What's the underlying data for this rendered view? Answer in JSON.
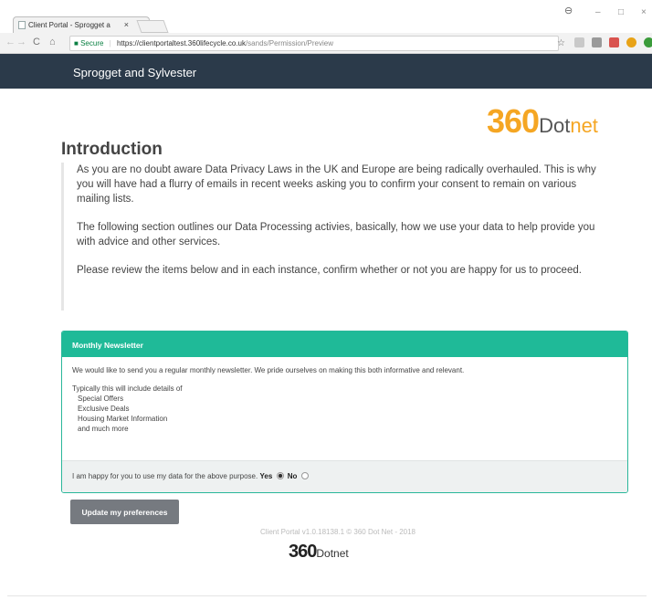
{
  "browser": {
    "tab_title": "Client Portal - Sprogget a",
    "tab_close": "×",
    "url_secure_label": "Secure",
    "url_host": "https://clientportaltest.360lifecycle.co.uk",
    "url_path": "/sands/Permission/Preview",
    "minimize": "–",
    "maximize": "□",
    "close": "×",
    "profile": "⊖"
  },
  "header": {
    "company_name": "Sprogget and Sylvester"
  },
  "logo": {
    "number": "360",
    "word_dot": "Dot",
    "word_net": "net"
  },
  "intro": {
    "title": "Introduction",
    "paragraphs": [
      "As you are no doubt aware Data Privacy Laws in the UK and Europe are being radically overhauled.  This is why you will have had a flurry of emails in recent weeks asking you to confirm your consent to remain on various mailing lists.",
      "The following section outlines our Data Processing activies, basically, how we use your data to help provide you with advice and other services.",
      "Please review the items below and in each instance, confirm whether or not you are happy for us to proceed."
    ]
  },
  "newsletter": {
    "title": "Monthly Newsletter",
    "lead": "We would like to send you a regular monthly newsletter.  We pride ourselves on making this both informative and relevant.",
    "list_title": "Typically this will include details of",
    "items": [
      "Special Offers",
      "Exclusive Deals",
      "Housing Market Information",
      "and much more"
    ],
    "consent_text": "I am happy for you to use my data for the above purpose.",
    "yes_label": "Yes",
    "no_label": "No",
    "selected": "Yes"
  },
  "actions": {
    "update_label": "Update my preferences"
  },
  "footer": {
    "text": "Client Portal v1.0.18138.1 © 360 Dot Net - 2018",
    "logo_number": "360",
    "logo_word": "Dotnet"
  },
  "colors": {
    "appbar": "#2b3a4a",
    "accent_teal": "#1fba98",
    "logo_orange": "#f5a623",
    "button_gray": "#767a80"
  }
}
